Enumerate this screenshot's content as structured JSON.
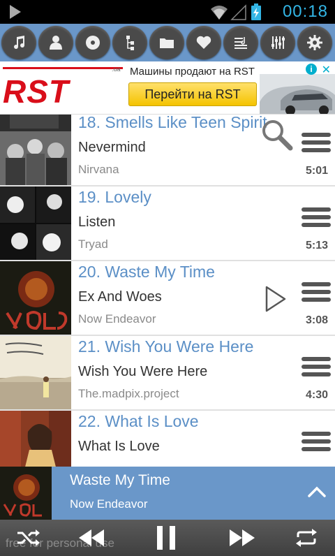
{
  "status_bar": {
    "time": "00:18"
  },
  "toolbar": {
    "buttons": [
      "music-note-icon",
      "person-icon",
      "disc-icon",
      "folder-tree-icon",
      "folder-icon",
      "heart-icon",
      "playlist-icon",
      "equalizer-icon",
      "gear-icon"
    ]
  },
  "ad": {
    "logo": "RST",
    "domain": ".ua",
    "text": "Машины продают на RST",
    "button_label": "Перейти на RST"
  },
  "tracks": [
    {
      "title": "18. Smells Like Teen Spirit",
      "album": "Nevermind",
      "artist": "Nirvana",
      "duration": "5:01"
    },
    {
      "title": "19. Lovely",
      "album": "Listen",
      "artist": "Tryad",
      "duration": "5:13"
    },
    {
      "title": "20. Waste My Time",
      "album": "Ex And Woes",
      "artist": "Now Endeavor",
      "duration": "3:08"
    },
    {
      "title": "21. Wish You Were Here",
      "album": "Wish You Were Here",
      "artist": "The.madpix.project",
      "duration": "4:30"
    },
    {
      "title": "22. What Is Love",
      "album": "What Is Love",
      "artist": "",
      "duration": ""
    }
  ],
  "now_playing": {
    "title": "Waste My Time",
    "artist": "Now Endeavor"
  },
  "controls": {
    "buttons": [
      "shuffle-icon",
      "rewind-icon",
      "pause-icon",
      "fast-forward-icon",
      "repeat-icon"
    ],
    "watermark": "free for personal use"
  },
  "colors": {
    "accent": "#6a97c9",
    "title_blue": "#5b8fc6",
    "status_time": "#33b5e5"
  }
}
